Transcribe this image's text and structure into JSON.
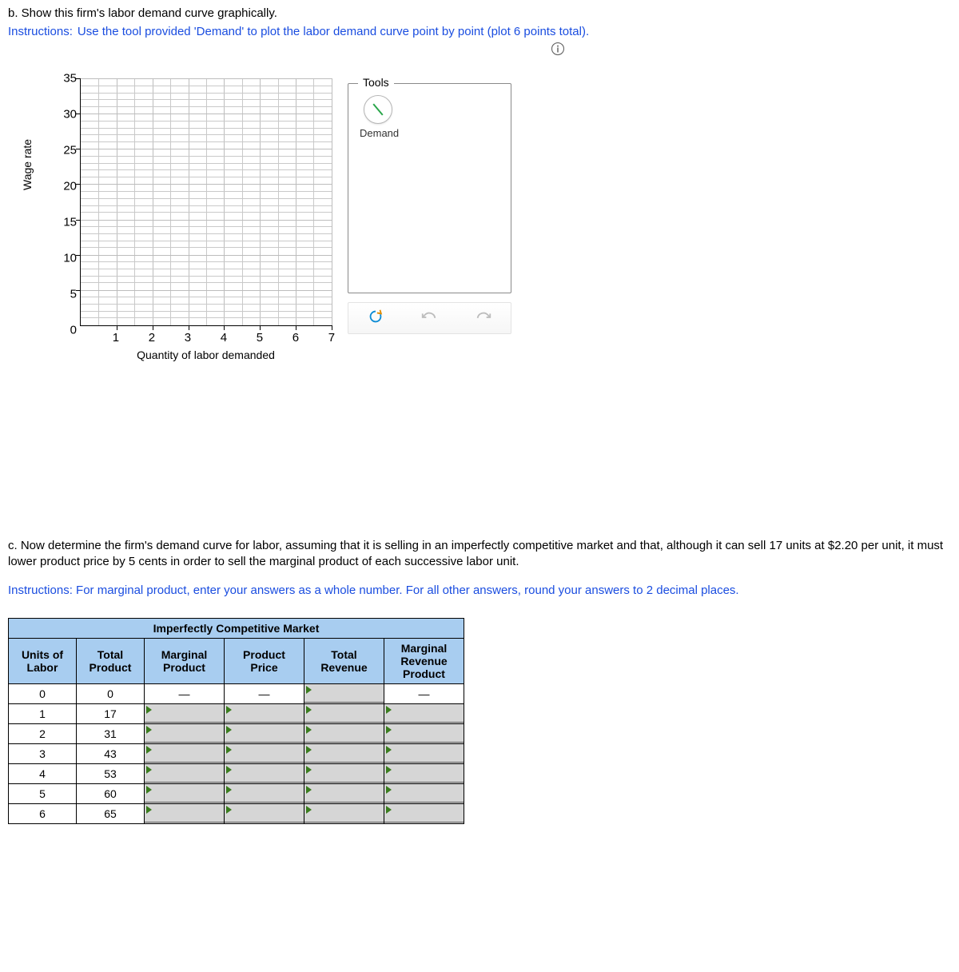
{
  "partB": {
    "label": "b. Show this firm's labor demand curve graphically.",
    "instructions_label": "Instructions:",
    "instructions_text": "Use the tool provided 'Demand' to plot the labor demand curve point by point (plot 6 points total)."
  },
  "chart_data": {
    "type": "scatter",
    "title": "",
    "xlabel": "Quantity of labor demanded",
    "ylabel": "Wage rate",
    "x_ticks": [
      1,
      2,
      3,
      4,
      5,
      6,
      7
    ],
    "y_ticks": [
      0,
      5,
      10,
      15,
      20,
      25,
      30,
      35
    ],
    "xlim": [
      0,
      7
    ],
    "ylim": [
      0,
      35
    ],
    "series": []
  },
  "tools": {
    "legend": "Tools",
    "demand_label": "Demand"
  },
  "partC": {
    "text": "c. Now determine the firm's demand curve for labor, assuming that it is selling in an imperfectly competitive market and that, although it can sell 17 units at $2.20 per unit, it must lower product price by 5 cents in order to sell the marginal product of each successive labor unit.",
    "instructions_label": "Instructions:",
    "instructions_text": "For marginal product, enter your answers as a whole number. For all other answers, round your answers to 2 decimal places."
  },
  "table": {
    "super_header": "Imperfectly Competitive Market",
    "headers": {
      "units": "Units of Labor",
      "total_product": "Total Product",
      "marginal_product": "Marginal Product",
      "product_price": "Product Price",
      "total_revenue": "Total Revenue",
      "mrp": "Marginal Revenue Product"
    },
    "dash": "—",
    "rows": [
      {
        "units": "0",
        "total_product": "0"
      },
      {
        "units": "1",
        "total_product": "17"
      },
      {
        "units": "2",
        "total_product": "31"
      },
      {
        "units": "3",
        "total_product": "43"
      },
      {
        "units": "4",
        "total_product": "53"
      },
      {
        "units": "5",
        "total_product": "60"
      },
      {
        "units": "6",
        "total_product": "65"
      }
    ]
  }
}
